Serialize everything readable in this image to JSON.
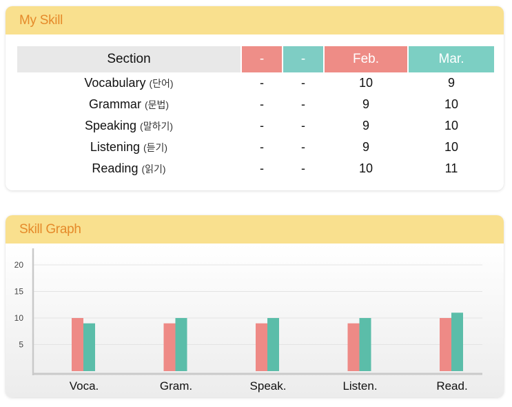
{
  "colors": {
    "col_neg1": "#ee8e88",
    "col_neg2": "#7ecdc4",
    "feb": "#ee8c86",
    "mar": "#7ccfc3",
    "bar_feb": "#ee8a86",
    "bar_mar": "#5bbda9",
    "header": "#f9e08e",
    "header_text": "#e58a2a"
  },
  "skill": {
    "title": "My Skill",
    "columns": [
      "Section",
      "-",
      "-",
      "Feb.",
      "Mar."
    ],
    "rows": [
      {
        "name": "Vocabulary",
        "ko": "(단어)",
        "c1": "-",
        "c2": "-",
        "feb": "10",
        "mar": "9"
      },
      {
        "name": "Grammar",
        "ko": "(문법)",
        "c1": "-",
        "c2": "-",
        "feb": "9",
        "mar": "10"
      },
      {
        "name": "Speaking",
        "ko": "(말하기)",
        "c1": "-",
        "c2": "-",
        "feb": "9",
        "mar": "10"
      },
      {
        "name": "Listening",
        "ko": "(듣기)",
        "c1": "-",
        "c2": "-",
        "feb": "9",
        "mar": "10"
      },
      {
        "name": "Reading",
        "ko": "(읽기)",
        "c1": "-",
        "c2": "-",
        "feb": "10",
        "mar": "11"
      }
    ]
  },
  "graph": {
    "title": "Skill Graph"
  },
  "chart_data": {
    "type": "bar",
    "title": "",
    "categories": [
      "Voca.",
      "Gram.",
      "Speak.",
      "Listen.",
      "Read."
    ],
    "series": [
      {
        "values": [
          10,
          9,
          9,
          9,
          10
        ]
      },
      {
        "values": [
          9,
          10,
          10,
          10,
          11
        ]
      }
    ],
    "yticks": [
      5,
      10,
      15,
      20
    ],
    "ylim": [
      0,
      20
    ],
    "grid": true,
    "legend": "none"
  }
}
